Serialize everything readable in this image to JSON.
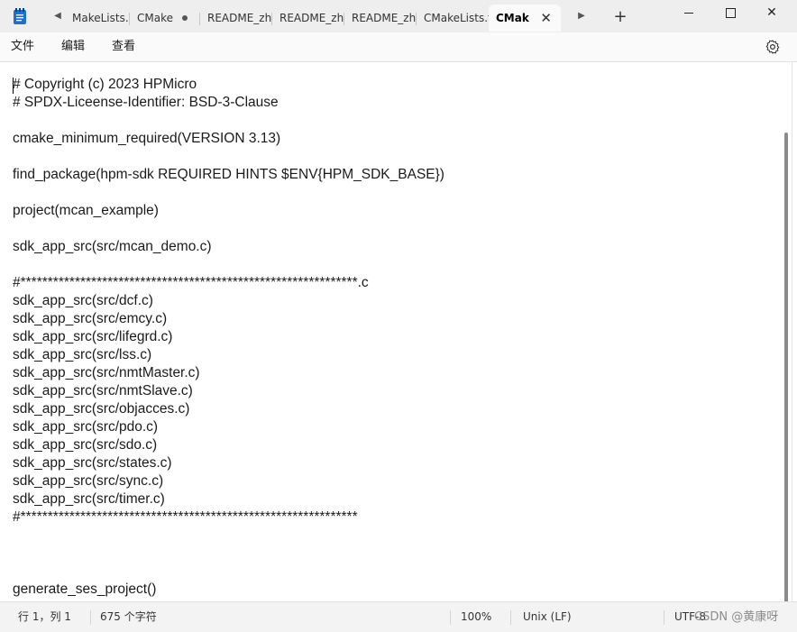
{
  "titlebar": {
    "tabs": [
      {
        "label": "MakeLists.t",
        "active": false
      },
      {
        "label": "CMake",
        "active": false,
        "modified": true
      },
      {
        "label": "README_zh.",
        "active": false
      },
      {
        "label": "README_zh.",
        "active": false
      },
      {
        "label": "README_zh.",
        "active": false
      },
      {
        "label": "CMakeLists.t",
        "active": false
      },
      {
        "label": "CMak",
        "active": true
      }
    ],
    "new_tab_glyph": "+",
    "close_glyph": "✕"
  },
  "menu": {
    "file": "文件",
    "edit": "编辑",
    "view": "查看"
  },
  "editor": {
    "lines": [
      "# Copyright (c) 2023 HPMicro",
      "# SPDX-Liceense-Identifier: BSD-3-Clause",
      "",
      "cmake_minimum_required(VERSION 3.13)",
      "",
      "find_package(hpm-sdk REQUIRED HINTS $ENV{HPM_SDK_BASE})",
      "",
      "project(mcan_example)",
      "",
      "sdk_app_src(src/mcan_demo.c)",
      "",
      "#**************************************************************.c",
      "sdk_app_src(src/dcf.c)",
      "sdk_app_src(src/emcy.c)",
      "sdk_app_src(src/lifegrd.c)",
      "sdk_app_src(src/lss.c)",
      "sdk_app_src(src/nmtMaster.c)",
      "sdk_app_src(src/nmtSlave.c)",
      "sdk_app_src(src/objacces.c)",
      "sdk_app_src(src/pdo.c)",
      "sdk_app_src(src/sdo.c)",
      "sdk_app_src(src/states.c)",
      "sdk_app_src(src/sync.c)",
      "sdk_app_src(src/timer.c)",
      "#**************************************************************",
      "",
      "",
      "",
      "generate_ses_project()"
    ]
  },
  "status": {
    "position": "行 1，列 1",
    "char_count": "675 个字符",
    "zoom": "100%",
    "line_ending": "Unix (LF)",
    "encoding": "UTF-8"
  },
  "watermark": "CSDN @黄康呀",
  "colors": {
    "titlebar_bg": "#eeeeee",
    "editor_bg": "#ffffff",
    "app_icon": "#1f6fd1"
  }
}
